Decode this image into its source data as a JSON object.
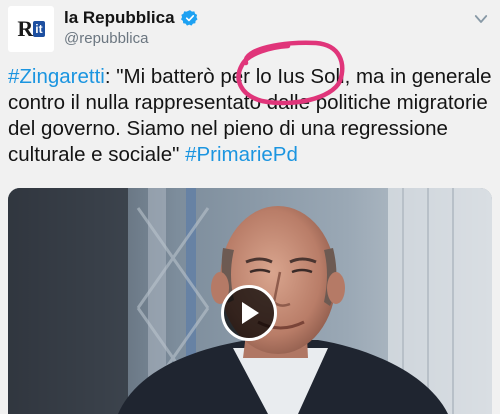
{
  "account": {
    "name": "la Repubblica",
    "handle": "@repubblica",
    "avatar_text": "R",
    "avatar_badge": "it",
    "verified_icon": "verified-badge-icon"
  },
  "tweet": {
    "hashtag_1": "#Zingaretti",
    "body": ": \"Mi batterò per lo Ius Soli, ma in generale contro il nulla rappresentato dalle politiche migratorie del governo. Siamo nel pieno di una regressione culturale e sociale\" ",
    "hashtag_2": "#PrimariePd"
  },
  "media": {
    "type": "video",
    "play_icon": "play-icon"
  },
  "colors": {
    "link": "#1b95e0",
    "verified": "#1da1f2",
    "annotation": "#e0357a",
    "background": "#f1f1f1"
  }
}
